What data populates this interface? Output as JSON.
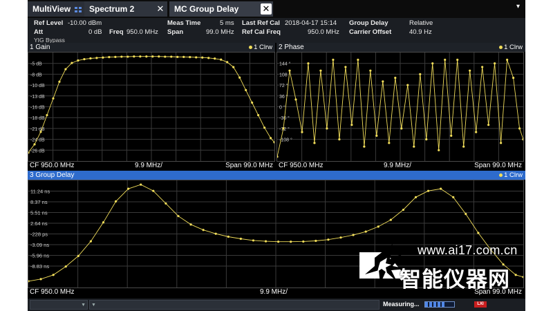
{
  "tabs": [
    {
      "label": "MultiView"
    },
    {
      "label": "Spectrum 2",
      "close": "✕"
    },
    {
      "label": "MC Group Delay",
      "close": "✕"
    }
  ],
  "tab_menu_icon": "dropdown-arrow-icon",
  "params": {
    "ref_level_label": "Ref Level",
    "ref_level_value": "-10.00 dBm",
    "att_label": "Att",
    "att_value": "0 dB",
    "freq_label": "Freq",
    "freq_value": "950.0 MHz",
    "yig": "YIG Bypass",
    "meas_time_label": "Meas Time",
    "meas_time_value": "5 ms",
    "span_label": "Span",
    "span_value": "99.0 MHz",
    "last_ref_cal_label": "Last Ref Cal",
    "last_ref_cal_value": "2018-04-17 15:14",
    "ref_cal_freq_label": "Ref Cal Freq",
    "ref_cal_freq_value": "950.0 MHz",
    "group_delay_label": "Group Delay",
    "group_delay_value": "Relative",
    "carrier_offset_label": "Carrier Offset",
    "carrier_offset_value": "40.9 Hz"
  },
  "colors": {
    "trace": "#f1dd5a",
    "header_blue": "#2e6bcc",
    "grid": "#3a3a3a",
    "background": "#000000"
  },
  "panels": {
    "gain": {
      "title": "1 Gain",
      "trace": "1 Clrw",
      "cf": "CF 950.0 MHz",
      "div": "9.9 MHz/",
      "span": "Span 99.0 MHz"
    },
    "phase": {
      "title": "2 Phase",
      "trace": "1 Clrw",
      "cf": "CF 950.0 MHz",
      "div": "9.9 MHz/",
      "span": "Span 99.0 MHz"
    },
    "delay": {
      "title": "3 Group Delay",
      "trace": "1 Clrw",
      "cf": "CF 950.0 MHz",
      "div": "9.9 MHz/",
      "span": "Span 99.0 MHz"
    }
  },
  "chart_data": [
    {
      "type": "line",
      "name": "gain",
      "title": "1 Gain",
      "y_ticks": [
        "-5 dB",
        "-8 dB",
        "-10 dB",
        "-13 dB",
        "-16 dB",
        "-18 dB",
        "-21 dB",
        "-24 dB",
        "-26 dB"
      ],
      "x_range": [
        900.5,
        999.5
      ],
      "y_range": [
        -28.5,
        -2.5
      ],
      "x": [
        900.5,
        903,
        905.5,
        908,
        910.5,
        913,
        915.5,
        918,
        920.5,
        923,
        925.5,
        928,
        930.5,
        933,
        935.5,
        938,
        940.5,
        943,
        945.5,
        948,
        950.5,
        953,
        955.5,
        958,
        960.5,
        963,
        965.5,
        968,
        970.5,
        973,
        975.5,
        978,
        980.5,
        983,
        985.5,
        988,
        990.5,
        993,
        995.5,
        998,
        999.5
      ],
      "y": [
        -26.5,
        -24.5,
        -21.5,
        -17.5,
        -13.5,
        -9.5,
        -6.5,
        -5.0,
        -4.4,
        -4.1,
        -3.9,
        -3.8,
        -3.7,
        -3.6,
        -3.55,
        -3.5,
        -3.5,
        -3.45,
        -3.45,
        -3.45,
        -3.45,
        -3.45,
        -3.5,
        -3.5,
        -3.55,
        -3.55,
        -3.6,
        -3.65,
        -3.7,
        -3.8,
        -3.95,
        -4.2,
        -4.8,
        -6.0,
        -8.5,
        -11.5,
        -14.5,
        -17.5,
        -20.5,
        -23.0,
        -24.0
      ]
    },
    {
      "type": "line",
      "name": "phase",
      "title": "2 Phase",
      "y_ticks": [
        "144 °",
        "108 °",
        "72 °",
        "36 °",
        "0 °",
        "-36 °",
        "-72 °",
        "-108 °"
      ],
      "x_range": [
        900.5,
        999.5
      ],
      "y_range": [
        -130,
        170
      ],
      "x": [
        900.5,
        903,
        905.5,
        908,
        910.5,
        913,
        915.5,
        918,
        920.5,
        923,
        925.5,
        928,
        930.5,
        933,
        935.5,
        938,
        940.5,
        943,
        945.5,
        948,
        950.5,
        953,
        955.5,
        958,
        960.5,
        963,
        965.5,
        968,
        970.5,
        973,
        975.5,
        978,
        980.5,
        983,
        985.5,
        988,
        990.5,
        993,
        995.5,
        998,
        999.5
      ],
      "y": [
        -118,
        -40,
        120,
        40,
        -50,
        140,
        -80,
        120,
        -40,
        150,
        -70,
        130,
        -30,
        150,
        -90,
        120,
        -60,
        90,
        -80,
        100,
        -40,
        80,
        -90,
        110,
        -70,
        140,
        -100,
        150,
        -60,
        150,
        -90,
        120,
        -50,
        130,
        -30,
        140,
        -80,
        150,
        100,
        -40,
        -70
      ]
    },
    {
      "type": "line",
      "name": "group_delay",
      "title": "3 Group Delay",
      "y_ticks": [
        "11.24 ns",
        "8.37 ns",
        "5.51 ns",
        "2.64 ns",
        "-228 ps",
        "-3.09 ns",
        "-5.96 ns",
        "-8.83 ns"
      ],
      "x_range": [
        900.5,
        999.5
      ],
      "y_range": [
        -12.5,
        13.0
      ],
      "x": [
        900.5,
        903,
        905.5,
        908,
        910.5,
        913,
        915.5,
        918,
        920.5,
        923,
        925.5,
        928,
        930.5,
        933,
        935.5,
        938,
        940.5,
        943,
        945.5,
        948,
        950.5,
        953,
        955.5,
        958,
        960.5,
        963,
        965.5,
        968,
        970.5,
        973,
        975.5,
        978,
        980.5,
        983,
        985.5,
        988,
        990.5,
        993,
        995.5,
        998,
        999.5
      ],
      "y": [
        -11.0,
        -10.5,
        -9.5,
        -7.5,
        -5.0,
        -1.5,
        3.0,
        8.0,
        11.0,
        12.0,
        10.5,
        7.5,
        4.5,
        2.5,
        1.2,
        0.3,
        -0.4,
        -0.9,
        -1.3,
        -1.5,
        -1.6,
        -1.6,
        -1.55,
        -1.4,
        -1.1,
        -0.6,
        0.0,
        0.8,
        2.0,
        3.6,
        6.0,
        9.0,
        10.5,
        11.0,
        9.0,
        5.0,
        0.5,
        -3.5,
        -7.0,
        -9.5,
        -10.0
      ]
    }
  ],
  "status": {
    "measuring": "Measuring...",
    "progress": 0.72,
    "lxi": "LXI"
  },
  "watermark": {
    "url": "www.ai17.com.cn",
    "text": "智能仪器网"
  }
}
